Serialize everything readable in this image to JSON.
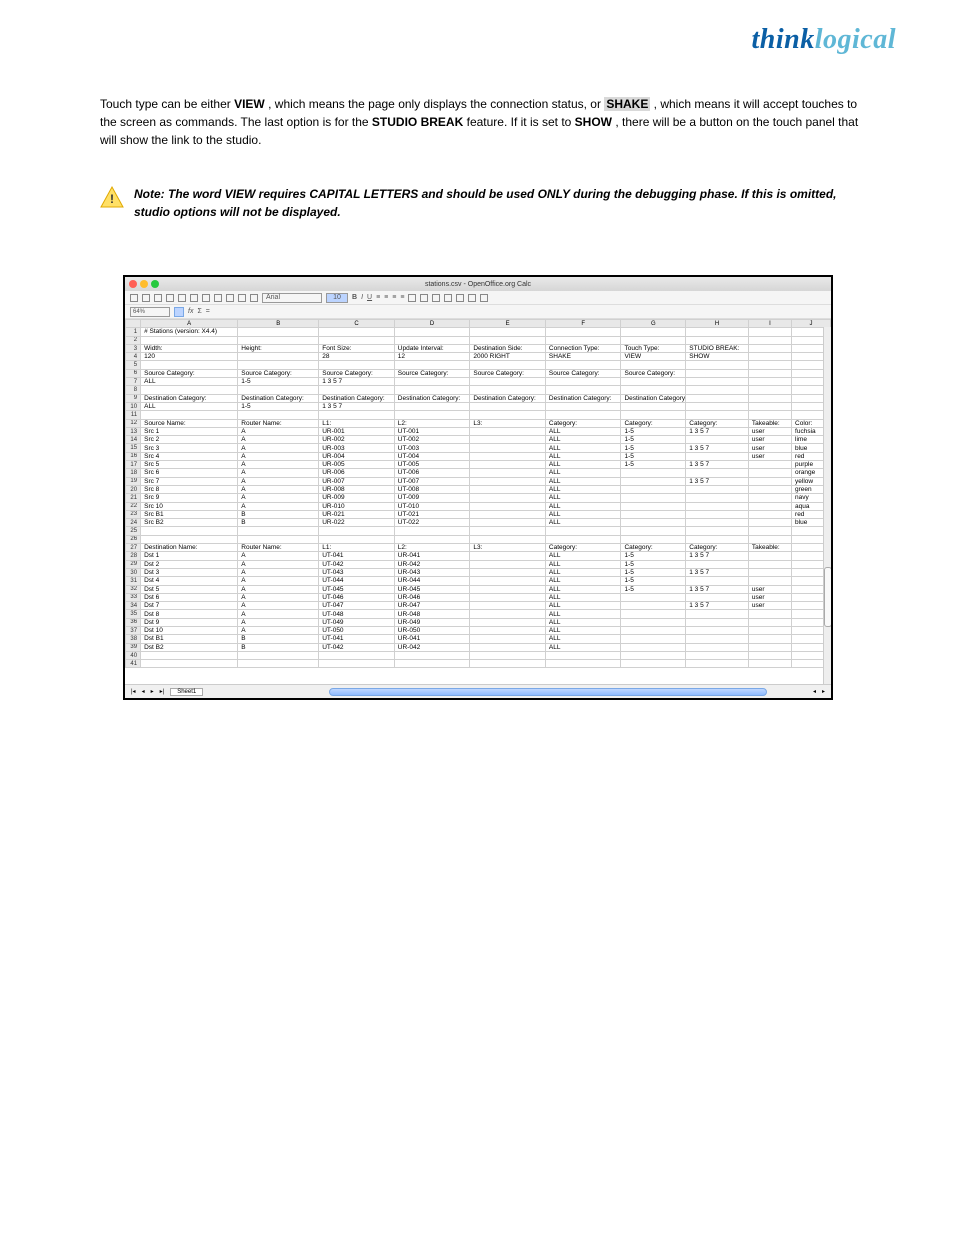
{
  "logo": {
    "part1": "think",
    "part2": "logical"
  },
  "doc": {
    "p1_a": "  Touch type can be either ",
    "p1_view": "VIEW",
    "p1_b": ", which means the page only displays the connection status, or ",
    "p1_shake": "SHAKE",
    "p1_c": ", which means it will accept touches to the screen as commands. The last option is for the ",
    "p1_studio": "STUDIO BREAK",
    "p1_d": " feature. If it is set to ",
    "p1_show": "SHOW",
    "p1_e": ", there will be a button on the touch panel that will show the link to the studio.",
    "note": "Note: The word VIEW requires CAPITAL LETTERS and should be used ONLY during the debugging phase. If this is omitted, studio options will not be displayed."
  },
  "window": {
    "title": "stations.csv - OpenOffice.org Calc",
    "zoom": "64%",
    "font_name": "Arial",
    "font_size": "10",
    "sheet_tab": "Sheet1"
  },
  "chart_data": {
    "type": "table",
    "columns": [
      "A",
      "B",
      "C",
      "D",
      "E",
      "F",
      "G",
      "H",
      "I",
      "J"
    ],
    "rows": [
      {
        "n": 1,
        "c": [
          "# Stations (version: X4.4)",
          "",
          "",
          "",
          "",
          "",
          "",
          "",
          "",
          ""
        ]
      },
      {
        "n": 2,
        "c": [
          "",
          "",
          "",
          "",
          "",
          "",
          "",
          "",
          "",
          ""
        ]
      },
      {
        "n": 3,
        "c": [
          "Width:",
          "Height:",
          "Font Size:",
          "Update Interval:",
          "Destination Side:",
          "Connection Type:",
          "Touch Type:",
          "STUDIO BREAK:",
          "",
          ""
        ]
      },
      {
        "n": 4,
        "c": [
          "120",
          "",
          "28",
          "12",
          "2000 RIGHT",
          "SHAKE",
          "VIEW",
          "SHOW",
          "",
          ""
        ]
      },
      {
        "n": 5,
        "c": [
          "",
          "",
          "",
          "",
          "",
          "",
          "",
          "",
          "",
          ""
        ]
      },
      {
        "n": 6,
        "c": [
          "Source Category:",
          "Source Category:",
          "Source Category:",
          "Source Category:",
          "Source Category:",
          "Source Category:",
          "Source Category:",
          "",
          "",
          ""
        ]
      },
      {
        "n": 7,
        "c": [
          "ALL",
          "1-5",
          "1 3 5 7",
          "",
          "",
          "",
          "",
          "",
          "",
          ""
        ]
      },
      {
        "n": 8,
        "c": [
          "",
          "",
          "",
          "",
          "",
          "",
          "",
          "",
          "",
          ""
        ]
      },
      {
        "n": 9,
        "c": [
          "Destination Category:",
          "Destination Category:",
          "Destination Category:",
          "Destination Category:",
          "Destination Category:",
          "Destination Category:",
          "Destination Category:",
          "",
          "",
          ""
        ]
      },
      {
        "n": 10,
        "c": [
          "ALL",
          "1-5",
          "1 3 5 7",
          "",
          "",
          "",
          "",
          "",
          "",
          ""
        ]
      },
      {
        "n": 11,
        "c": [
          "",
          "",
          "",
          "",
          "",
          "",
          "",
          "",
          "",
          ""
        ]
      },
      {
        "n": 12,
        "c": [
          "Source Name:",
          "Router Name:",
          "L1:",
          "L2:",
          "L3:",
          "Category:",
          "Category:",
          "Category:",
          "Takeable:",
          "Color:"
        ]
      },
      {
        "n": 13,
        "c": [
          "Src 1",
          "A",
          "UR-001",
          "UT-001",
          "",
          "ALL",
          "1-5",
          "1 3 5 7",
          "user",
          "fuchsia"
        ]
      },
      {
        "n": 14,
        "c": [
          "Src 2",
          "A",
          "UR-002",
          "UT-002",
          "",
          "ALL",
          "1-5",
          "",
          "user",
          "lime"
        ]
      },
      {
        "n": 15,
        "c": [
          "Src 3",
          "A",
          "UR-003",
          "UT-003",
          "",
          "ALL",
          "1-5",
          "1 3 5 7",
          "user",
          "blue"
        ]
      },
      {
        "n": 16,
        "c": [
          "Src 4",
          "A",
          "UR-004",
          "UT-004",
          "",
          "ALL",
          "1-5",
          "",
          "user",
          "red"
        ]
      },
      {
        "n": 17,
        "c": [
          "Src 5",
          "A",
          "UR-005",
          "UT-005",
          "",
          "ALL",
          "1-5",
          "1 3 5 7",
          "",
          "purple"
        ]
      },
      {
        "n": 18,
        "c": [
          "Src 6",
          "A",
          "UR-006",
          "UT-006",
          "",
          "ALL",
          "",
          "",
          "",
          "orange"
        ]
      },
      {
        "n": 19,
        "c": [
          "Src 7",
          "A",
          "UR-007",
          "UT-007",
          "",
          "ALL",
          "",
          "1 3 5 7",
          "",
          "yellow"
        ]
      },
      {
        "n": 20,
        "c": [
          "Src 8",
          "A",
          "UR-008",
          "UT-008",
          "",
          "ALL",
          "",
          "",
          "",
          "green"
        ]
      },
      {
        "n": 21,
        "c": [
          "Src 9",
          "A",
          "UR-009",
          "UT-009",
          "",
          "ALL",
          "",
          "",
          "",
          "navy"
        ]
      },
      {
        "n": 22,
        "c": [
          "Src 10",
          "A",
          "UR-010",
          "UT-010",
          "",
          "ALL",
          "",
          "",
          "",
          "aqua"
        ]
      },
      {
        "n": 23,
        "c": [
          "Src B1",
          "B",
          "UR-021",
          "UT-021",
          "",
          "ALL",
          "",
          "",
          "",
          "red"
        ]
      },
      {
        "n": 24,
        "c": [
          "Src B2",
          "B",
          "UR-022",
          "UT-022",
          "",
          "ALL",
          "",
          "",
          "",
          "blue"
        ]
      },
      {
        "n": 25,
        "c": [
          "",
          "",
          "",
          "",
          "",
          "",
          "",
          "",
          "",
          ""
        ]
      },
      {
        "n": 26,
        "c": [
          "",
          "",
          "",
          "",
          "",
          "",
          "",
          "",
          "",
          ""
        ]
      },
      {
        "n": 27,
        "c": [
          "Destination Name:",
          "Router Name:",
          "L1:",
          "L2:",
          "L3:",
          "Category:",
          "Category:",
          "Category:",
          "Takeable:",
          ""
        ]
      },
      {
        "n": 28,
        "c": [
          "Dst 1",
          "A",
          "UT-041",
          "UR-041",
          "",
          "ALL",
          "1-5",
          "1 3 5 7",
          "",
          ""
        ]
      },
      {
        "n": 29,
        "c": [
          "Dst 2",
          "A",
          "UT-042",
          "UR-042",
          "",
          "ALL",
          "1-5",
          "",
          "",
          ""
        ]
      },
      {
        "n": 30,
        "c": [
          "Dst 3",
          "A",
          "UT-043",
          "UR-043",
          "",
          "ALL",
          "1-5",
          "1 3 5 7",
          "",
          ""
        ]
      },
      {
        "n": 31,
        "c": [
          "Dst 4",
          "A",
          "UT-044",
          "UR-044",
          "",
          "ALL",
          "1-5",
          "",
          "",
          ""
        ]
      },
      {
        "n": 32,
        "c": [
          "Dst 5",
          "A",
          "UT-045",
          "UR-045",
          "",
          "ALL",
          "1-5",
          "1 3 5 7",
          "user",
          ""
        ]
      },
      {
        "n": 33,
        "c": [
          "Dst 6",
          "A",
          "UT-046",
          "UR-046",
          "",
          "ALL",
          "",
          "",
          "user",
          ""
        ]
      },
      {
        "n": 34,
        "c": [
          "Dst 7",
          "A",
          "UT-047",
          "UR-047",
          "",
          "ALL",
          "",
          "1 3 5 7",
          "user",
          ""
        ]
      },
      {
        "n": 35,
        "c": [
          "Dst 8",
          "A",
          "UT-048",
          "UR-048",
          "",
          "ALL",
          "",
          "",
          "",
          ""
        ]
      },
      {
        "n": 36,
        "c": [
          "Dst 9",
          "A",
          "UT-049",
          "UR-049",
          "",
          "ALL",
          "",
          "",
          "",
          ""
        ]
      },
      {
        "n": 37,
        "c": [
          "Dst 10",
          "A",
          "UT-050",
          "UR-050",
          "",
          "ALL",
          "",
          "",
          "",
          ""
        ]
      },
      {
        "n": 38,
        "c": [
          "Dst B1",
          "B",
          "UT-041",
          "UR-041",
          "",
          "ALL",
          "",
          "",
          "",
          ""
        ]
      },
      {
        "n": 39,
        "c": [
          "Dst B2",
          "B",
          "UT-042",
          "UR-042",
          "",
          "ALL",
          "",
          "",
          "",
          ""
        ]
      },
      {
        "n": 40,
        "c": [
          "",
          "",
          "",
          "",
          "",
          "",
          "",
          "",
          "",
          ""
        ]
      },
      {
        "n": 41,
        "c": [
          "",
          "",
          "",
          "",
          "",
          "",
          "",
          "",
          "",
          ""
        ]
      }
    ]
  }
}
